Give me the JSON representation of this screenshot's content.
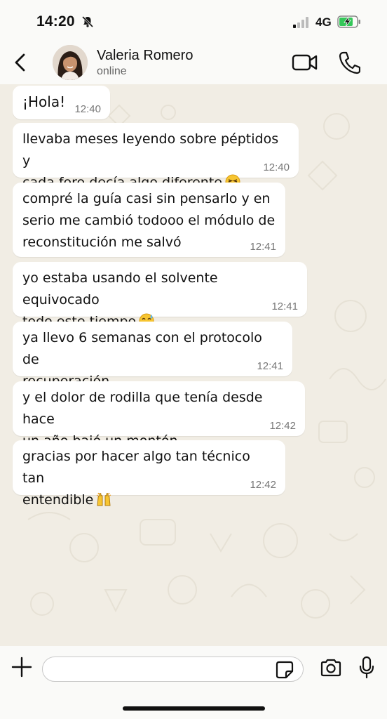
{
  "status_bar": {
    "time": "14:20",
    "network": "4G",
    "icons": [
      "bell-slash-icon",
      "signal-icon",
      "battery-charging-icon"
    ]
  },
  "header": {
    "contact_name": "Valeria Romero",
    "contact_status": "online",
    "icons": [
      "chevron-left-icon",
      "video-camera-icon",
      "phone-icon"
    ]
  },
  "messages": [
    {
      "text": "¡Hola!",
      "time": "12:40"
    },
    {
      "text": "llevaba meses leyendo sobre péptidos y\ncada foro decía algo diferente",
      "time": "12:40",
      "emoji": "tired-face-emoji"
    },
    {
      "text": "compré la guía casi sin pensarlo y en\nserio me cambió todooo el módulo de\nreconstitución me salvó",
      "time": "12:41"
    },
    {
      "text": "yo estaba usando el solvente equivocado\ntodo este tiempo",
      "time": "12:41",
      "emoji": "grinning-sweat-emoji"
    },
    {
      "text": "ya llevo 6 semanas con el protocolo de\nrecuperación",
      "time": "12:41"
    },
    {
      "text": "y el dolor de rodilla que tenía desde hace\nun año bajó un montón",
      "time": "12:42"
    },
    {
      "text": "gracias por hacer algo tan técnico tan\nentendible",
      "time": "12:42",
      "emoji": "raising-hands-emoji"
    }
  ],
  "composer": {
    "input_value": "",
    "icons": [
      "plus-icon",
      "sticker-icon",
      "camera-icon",
      "microphone-icon"
    ]
  },
  "colors": {
    "chat_background": "#f1ede4",
    "bubble": "#ffffff",
    "battery_fill": "#34c759"
  }
}
